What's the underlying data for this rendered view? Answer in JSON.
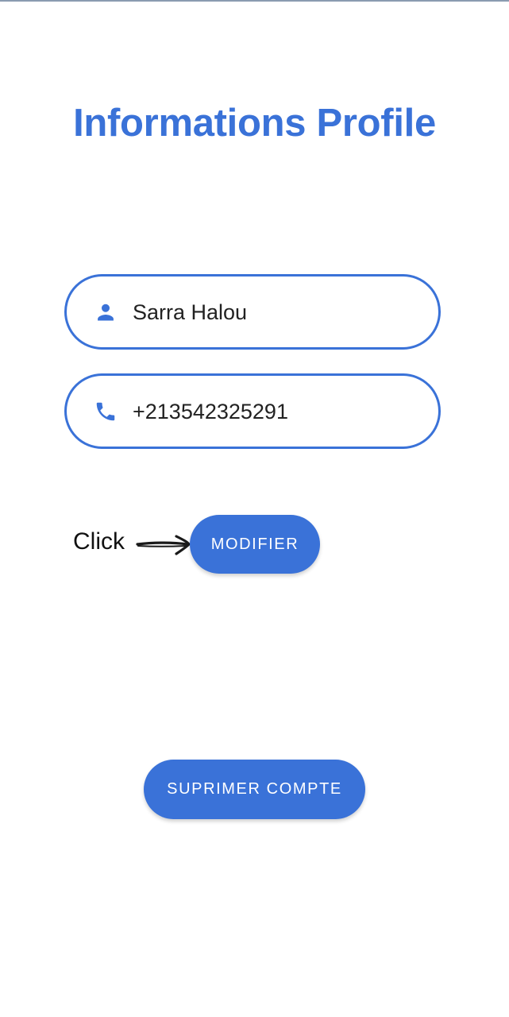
{
  "page": {
    "title": "Informations Profile"
  },
  "fields": {
    "name": {
      "icon": "person-icon",
      "value": "Sarra Halou"
    },
    "phone": {
      "icon": "phone-icon",
      "value": "+213542325291"
    }
  },
  "annotation": {
    "label": "Click",
    "icon": "arrow-right-icon"
  },
  "buttons": {
    "modifier_label": "MODIFIER",
    "delete_label": "SUPRIMER COMPTE"
  },
  "colors": {
    "accent": "#3a72d8",
    "text": "#222222",
    "background": "#ffffff"
  }
}
